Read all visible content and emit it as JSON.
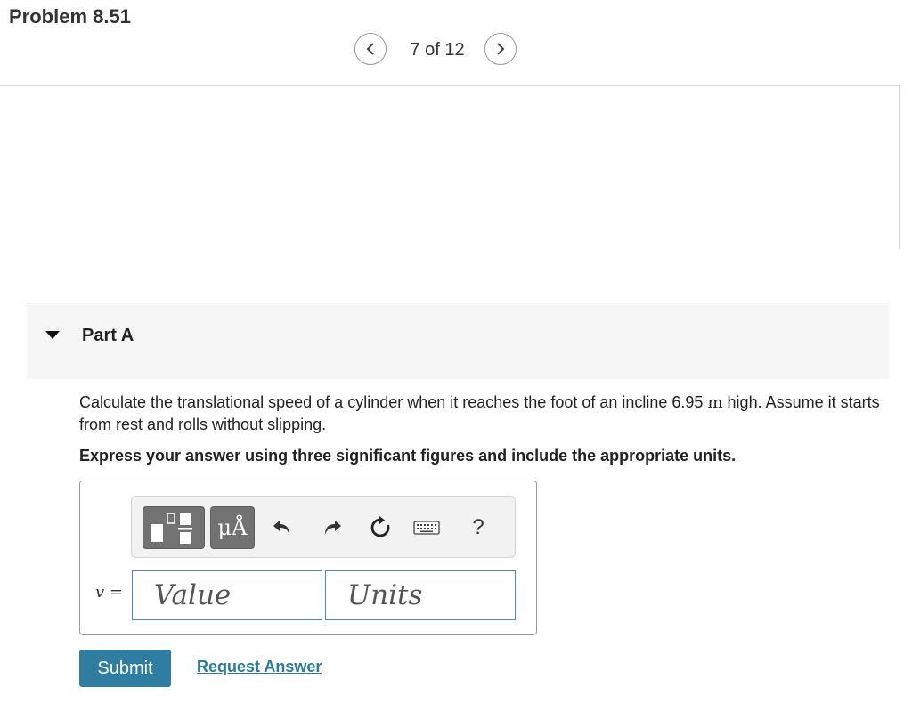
{
  "page": {
    "title": "Problem 8.51"
  },
  "pager": {
    "text": "7 of 12",
    "prev_icon": "chevron-left-icon",
    "next_icon": "chevron-right-icon"
  },
  "part": {
    "label": "Part A",
    "caret_icon": "caret-down-icon"
  },
  "question": {
    "text_before": "Calculate the translational speed of a cylinder when it reaches the foot of an incline 6.95",
    "unit": "m",
    "text_after": "high. Assume it starts from rest and rolls without slipping.",
    "instruction": "Express your answer using three significant figures and include the appropriate units."
  },
  "toolbar": {
    "items": [
      {
        "name": "templates-icon"
      },
      {
        "name": "units-icon",
        "label": "μÅ"
      },
      {
        "name": "undo-icon"
      },
      {
        "name": "redo-icon"
      },
      {
        "name": "reset-icon"
      },
      {
        "name": "keyboard-icon"
      },
      {
        "name": "help-icon",
        "label": "?"
      }
    ]
  },
  "answer": {
    "variable": "v",
    "equals": "=",
    "value_placeholder": "Value",
    "units_placeholder": "Units"
  },
  "actions": {
    "submit_label": "Submit",
    "request_label": "Request Answer"
  },
  "colors": {
    "accent": "#2f7da1",
    "link": "#2a7aa3",
    "field_border": "#4b8fb3",
    "toolbar_button": "#727272"
  }
}
